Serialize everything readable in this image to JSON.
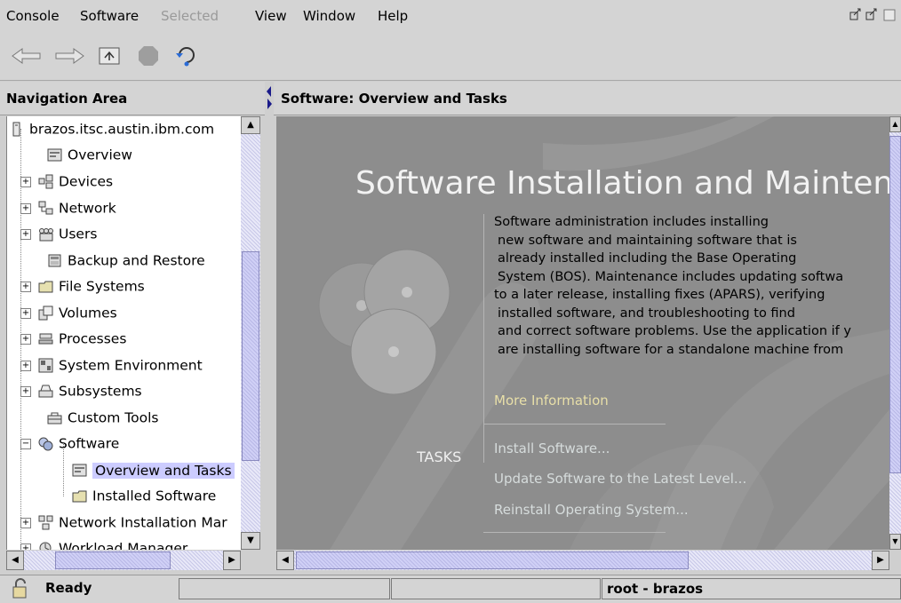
{
  "menubar": {
    "items": [
      "Console",
      "Software",
      "Selected",
      "View",
      "Window",
      "Help"
    ]
  },
  "nav": {
    "header": "Navigation Area",
    "items": [
      {
        "label": "brazos.itsc.austin.ibm.com",
        "icon": "server-icon"
      },
      {
        "label": "Overview",
        "icon": "overview-icon"
      },
      {
        "label": "Devices",
        "icon": "devices-icon"
      },
      {
        "label": "Network",
        "icon": "network-icon"
      },
      {
        "label": "Users",
        "icon": "users-icon"
      },
      {
        "label": "Backup and Restore",
        "icon": "backup-icon"
      },
      {
        "label": "File Systems",
        "icon": "folder-icon"
      },
      {
        "label": "Volumes",
        "icon": "volumes-icon"
      },
      {
        "label": "Processes",
        "icon": "processes-icon"
      },
      {
        "label": "System Environment",
        "icon": "system-environment-icon"
      },
      {
        "label": "Subsystems",
        "icon": "subsystems-icon"
      },
      {
        "label": "Custom Tools",
        "icon": "toolbox-icon"
      },
      {
        "label": "Software",
        "icon": "software-icon"
      },
      {
        "label": "Overview and Tasks",
        "icon": "overview-icon"
      },
      {
        "label": "Installed Software",
        "icon": "folder-icon"
      },
      {
        "label": "Network Installation Mar",
        "icon": "network-install-icon"
      },
      {
        "label": "Workload Manager",
        "icon": "workload-icon"
      }
    ]
  },
  "content": {
    "header": "Software: Overview and Tasks",
    "title": "Software Installation and Maintenan",
    "description": [
      "Software administration includes installing",
      "new software and maintaining software that is",
      "already installed including the Base Operating",
      "System (BOS).  Maintenance includes updating softwa",
      "to a later release, installing fixes (APARS), verifying",
      "installed software, and troubleshooting to find",
      "and correct software problems.  Use the application if y",
      "are installing software for a standalone machine from"
    ],
    "more_info": "More Information",
    "tasks_label": "TASKS",
    "tasks": [
      "Install Software...",
      "Update Software to the Latest Level...",
      "Reinstall Operating System..."
    ]
  },
  "status": {
    "state": "Ready",
    "user": "root - brazos"
  }
}
